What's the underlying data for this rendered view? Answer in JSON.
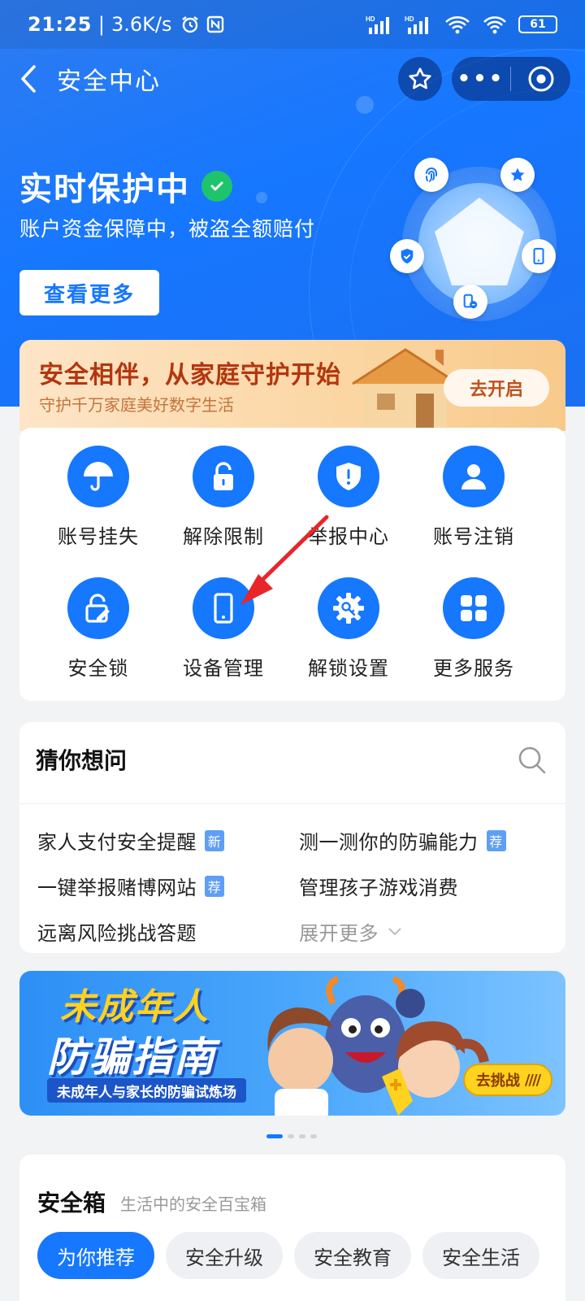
{
  "status_bar": {
    "time": "21:25",
    "speed": "3.6K/s",
    "battery": "61"
  },
  "nav": {
    "title": "安全中心"
  },
  "hero": {
    "title": "实时保护中",
    "subtitle": "账户资金保障中，被盗全额赔付",
    "button": "查看更多"
  },
  "family_banner": {
    "title": "安全相伴，从家庭守护开始",
    "subtitle": "守护千万家庭美好数字生活",
    "button": "去开启"
  },
  "services": [
    {
      "label": "账号挂失",
      "icon": "umbrella-icon"
    },
    {
      "label": "解除限制",
      "icon": "unlock-icon"
    },
    {
      "label": "举报中心",
      "icon": "shield-alert-icon"
    },
    {
      "label": "账号注销",
      "icon": "user-icon"
    },
    {
      "label": "安全锁",
      "icon": "lock-edit-icon"
    },
    {
      "label": "设备管理",
      "icon": "phone-icon"
    },
    {
      "label": "解锁设置",
      "icon": "gear-key-icon"
    },
    {
      "label": "更多服务",
      "icon": "grid-icon"
    }
  ],
  "guess": {
    "title": "猜你想问",
    "items": [
      {
        "text": "家人支付安全提醒",
        "tag": "新"
      },
      {
        "text": "测一测你的防骗能力",
        "tag": "荐"
      },
      {
        "text": "一键举报赌博网站",
        "tag": "荐"
      },
      {
        "text": "管理孩子游戏消费",
        "tag": ""
      },
      {
        "text": "远离风险挑战答题",
        "tag": ""
      }
    ],
    "expand": "展开更多"
  },
  "promo": {
    "title_line1": "未成年人",
    "title_line2": "防骗指南",
    "subtitle": "未成年人与家长的防骗试炼场",
    "button": "去挑战"
  },
  "safebox": {
    "title": "安全箱",
    "subtitle": "生活中的安全百宝箱",
    "tabs": [
      "为你推荐",
      "安全升级",
      "安全教育",
      "安全生活"
    ]
  },
  "colors": {
    "primary": "#1677ff",
    "success": "#1ec46b",
    "annotation_arrow": "#e8262a"
  }
}
